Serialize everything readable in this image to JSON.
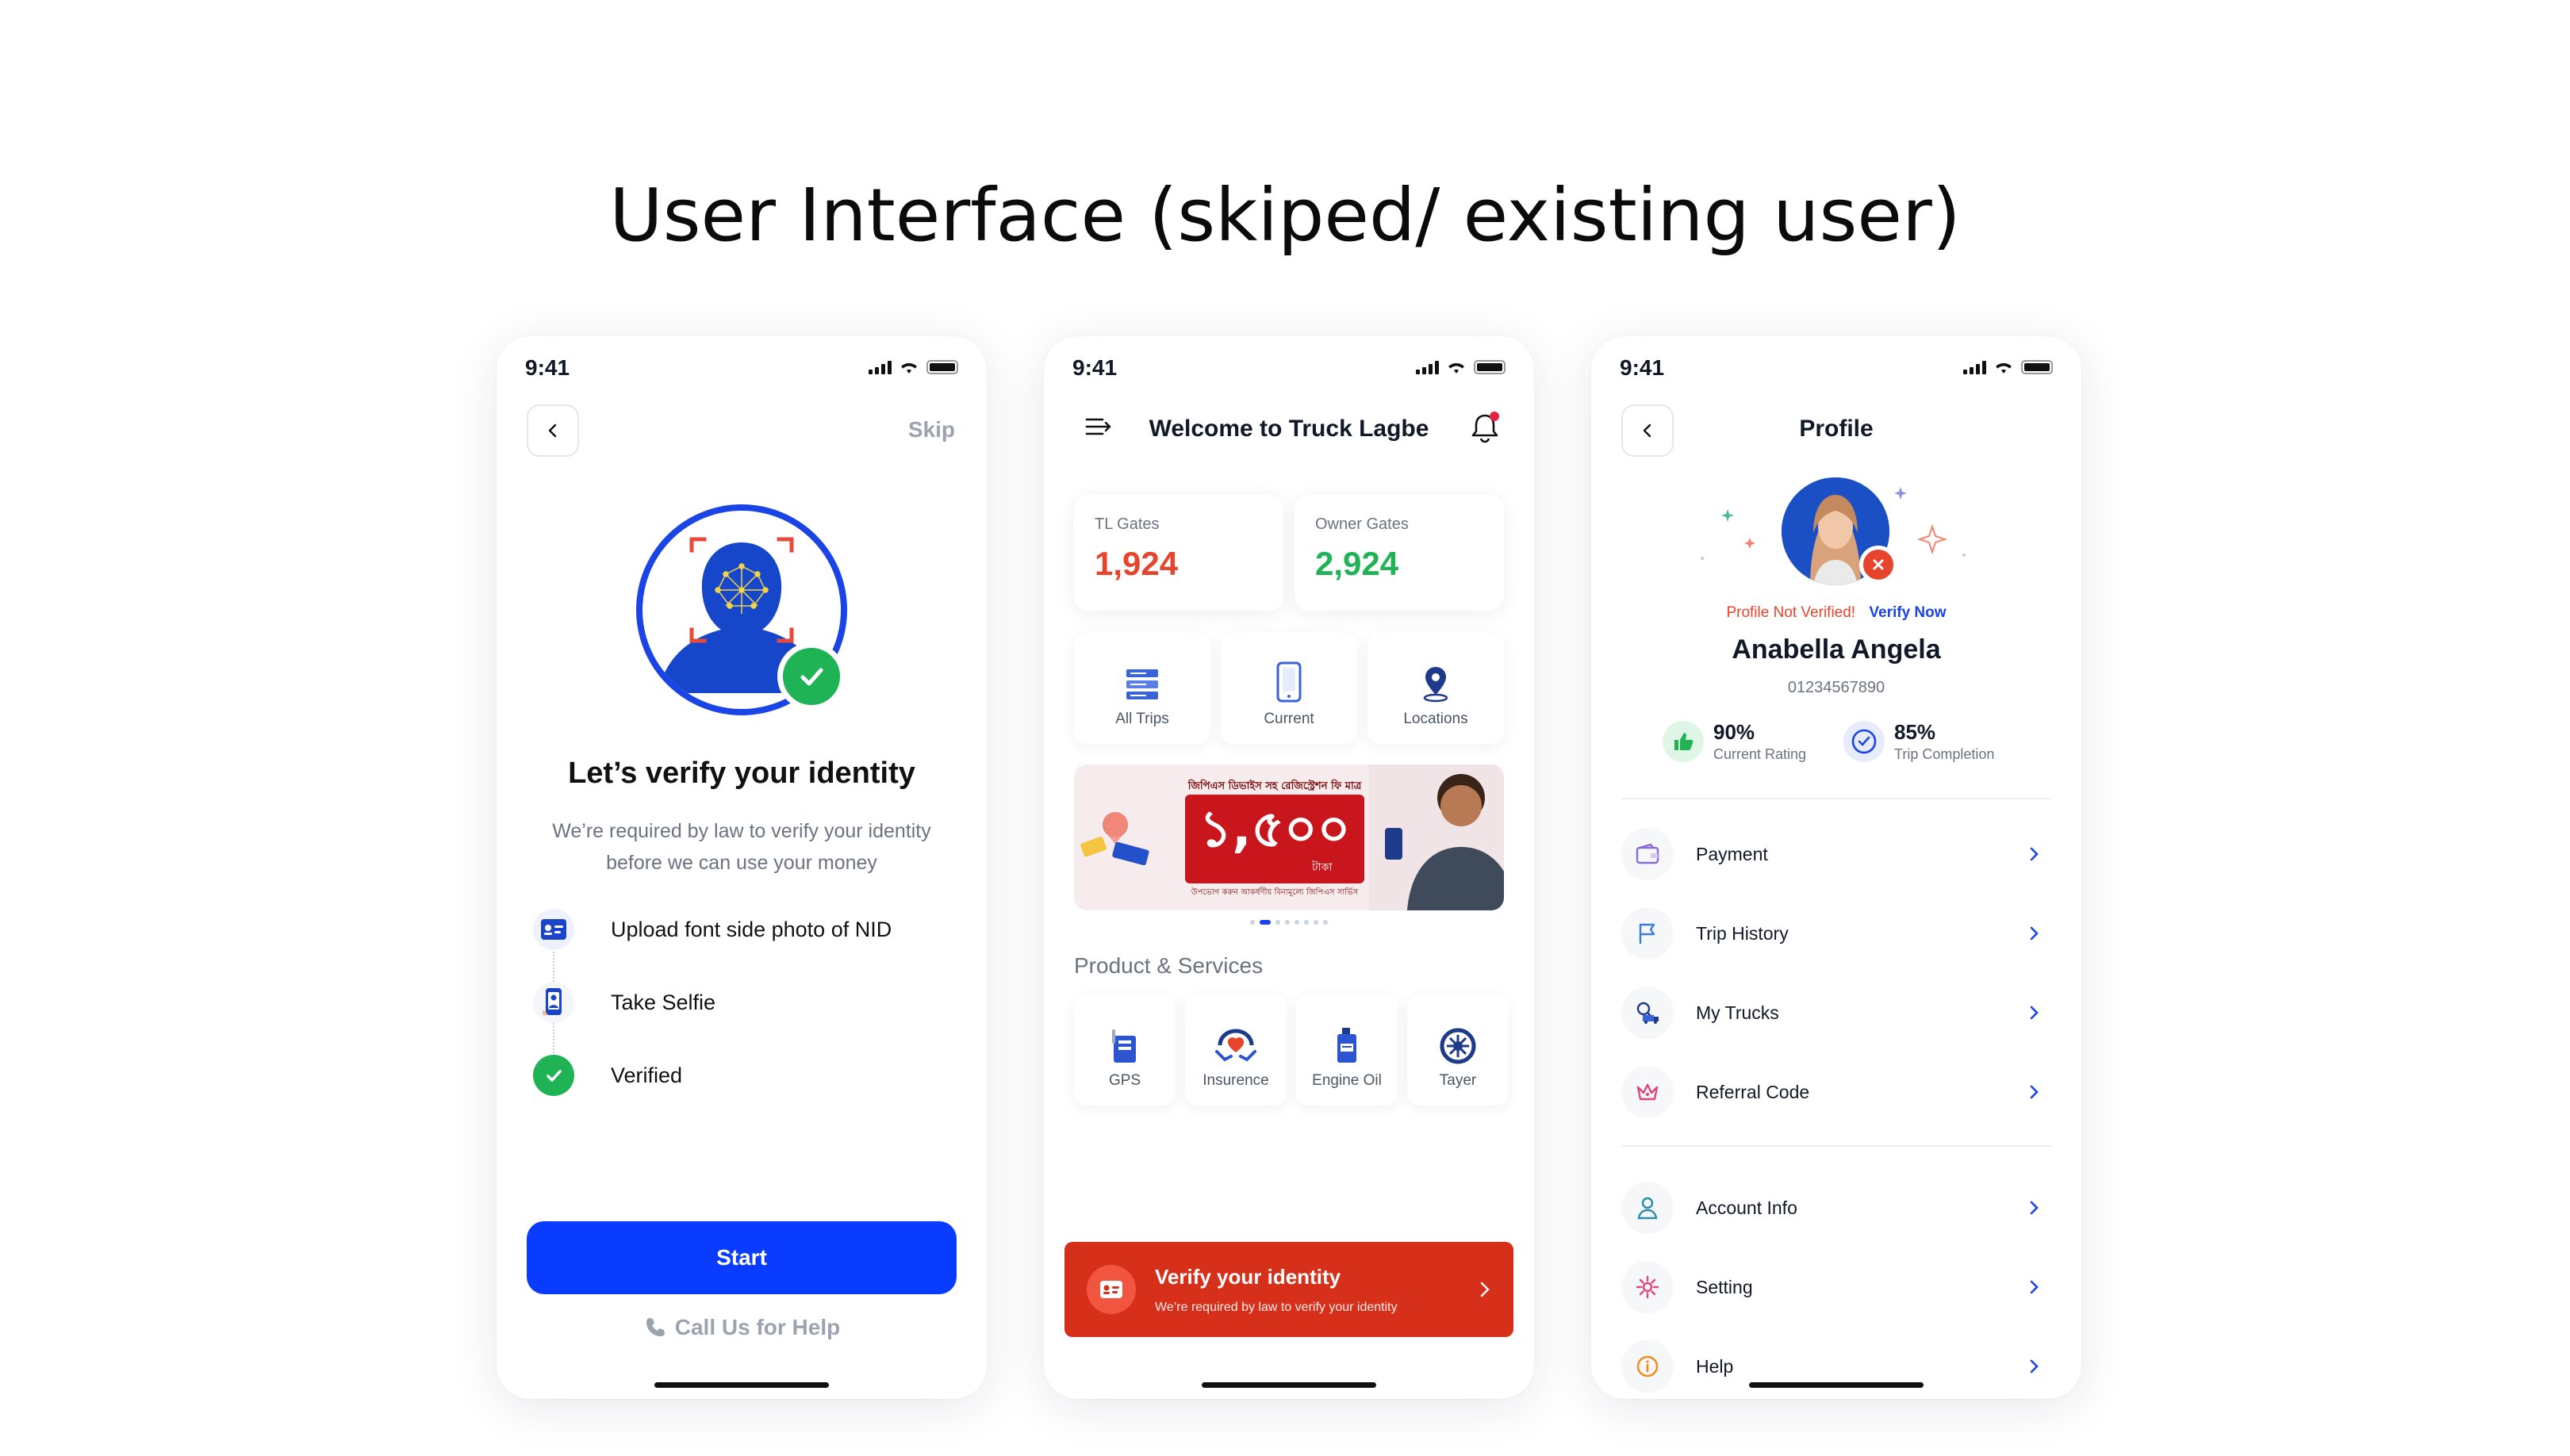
{
  "page_title": "User Interface (skiped/ existing user)",
  "status_time": "9:41",
  "screen1": {
    "skip_label": "Skip",
    "title": "Let’s verify your identity",
    "subtitle_line1": "We’re required by law to verify your identity",
    "subtitle_line2": "before we can use your money",
    "steps": [
      {
        "label": "Upload font side photo of NID"
      },
      {
        "label": "Take Selfie"
      },
      {
        "label": "Verified"
      }
    ],
    "start_label": "Start",
    "call_help_label": "Call Us for Help"
  },
  "screen2": {
    "header_title": "Welcome to Truck Lagbe",
    "gates": [
      {
        "label": "TL Gates",
        "value": "1,924",
        "color": "#e6442c"
      },
      {
        "label": "Owner Gates",
        "value": "2,924",
        "color": "#1fb356"
      }
    ],
    "tiles": [
      {
        "label": "All Trips"
      },
      {
        "label": "Current"
      },
      {
        "label": "Locations"
      }
    ],
    "banner": {
      "headline": "জিপিএস ডিভাইস সহ রেজিস্ট্রেশন ফি মাত্র",
      "amount": "১,৫০০",
      "unit": "টাকা",
      "footer": "উপভোগ করুন আকর্ষণীয় বিনামূল্যে জিপিএস সার্ভিস"
    },
    "section_title": "Product & Services",
    "products": [
      {
        "label": "GPS"
      },
      {
        "label": "Insurence"
      },
      {
        "label": "Engine Oil"
      },
      {
        "label": "Tayer"
      }
    ],
    "verify_card": {
      "title": "Verify your identity",
      "subtitle": "We’re required by law to verify your identity"
    }
  },
  "screen3": {
    "header_title": "Profile",
    "not_verified_label": "Profile Not Verified!",
    "verify_now_label": "Verify Now",
    "name": "Anabella Angela",
    "phone": "01234567890",
    "stats": [
      {
        "value": "90%",
        "label": "Current Rating"
      },
      {
        "value": "85%",
        "label": "Trip Completion"
      }
    ],
    "menu_group1": [
      {
        "label": "Payment"
      },
      {
        "label": "Trip History"
      },
      {
        "label": "My Trucks"
      },
      {
        "label": "Referral Code"
      }
    ],
    "menu_group2": [
      {
        "label": "Account Info"
      },
      {
        "label": "Setting"
      },
      {
        "label": "Help"
      }
    ]
  },
  "colors": {
    "primary": "#0a3cff",
    "danger": "#e6442c",
    "success": "#1fb356",
    "verify_card": "#d6301b"
  }
}
